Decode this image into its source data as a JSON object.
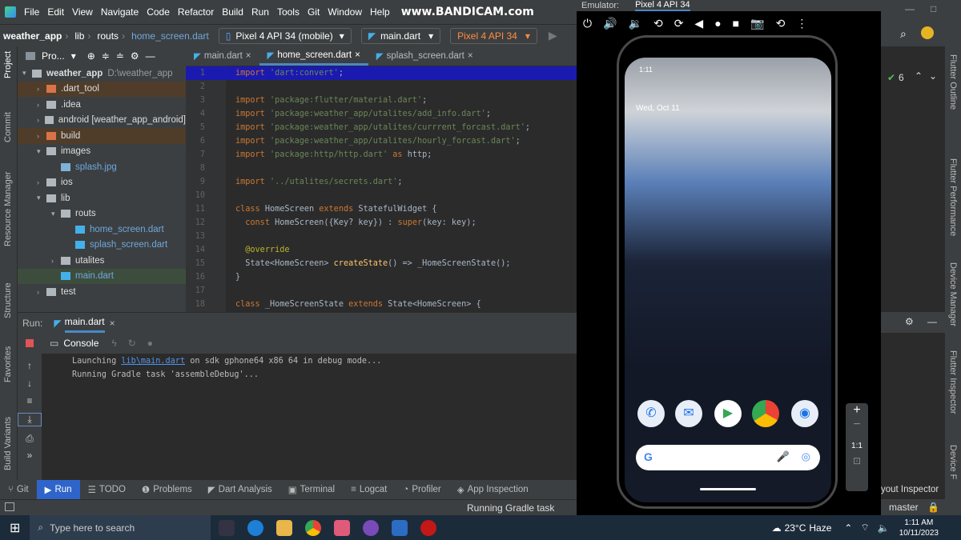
{
  "menubar": {
    "items": [
      "File",
      "Edit",
      "View",
      "Navigate",
      "Code",
      "Refactor",
      "Build",
      "Run",
      "Tools",
      "Git",
      "Window",
      "Help"
    ],
    "watermark": "www.BANDICAM.com"
  },
  "navbar": {
    "project": "weather_app",
    "crumbs": [
      "lib",
      "routs",
      "home_screen.dart"
    ],
    "device_combo": "Pixel 4 API 34 (mobile)",
    "run_config": "main.dart",
    "device_combo2": "Pixel 4 API 34"
  },
  "project_panel": {
    "header": "Pro...",
    "items": [
      {
        "label": "weather_app",
        "extra": "D:\\weather_app",
        "indent": 0,
        "type": "folder",
        "open": true
      },
      {
        "label": ".dart_tool",
        "indent": 1,
        "type": "folder-orange",
        "open": false
      },
      {
        "label": ".idea",
        "indent": 1,
        "type": "folder",
        "open": false
      },
      {
        "label": "android [weather_app_android]",
        "indent": 1,
        "type": "folder",
        "open": false
      },
      {
        "label": "build",
        "indent": 1,
        "type": "folder-orange",
        "open": false
      },
      {
        "label": "images",
        "indent": 1,
        "type": "folder",
        "open": true
      },
      {
        "label": "splash.jpg",
        "indent": 2,
        "type": "file",
        "open": null
      },
      {
        "label": "ios",
        "indent": 1,
        "type": "folder",
        "open": false
      },
      {
        "label": "lib",
        "indent": 1,
        "type": "folder",
        "open": true
      },
      {
        "label": "routs",
        "indent": 2,
        "type": "folder",
        "open": true
      },
      {
        "label": "home_screen.dart",
        "indent": 3,
        "type": "dart",
        "open": null
      },
      {
        "label": "splash_screen.dart",
        "indent": 3,
        "type": "dart",
        "open": null
      },
      {
        "label": "utalites",
        "indent": 2,
        "type": "folder",
        "open": false
      },
      {
        "label": "main.dart",
        "indent": 2,
        "type": "dart",
        "open": null
      },
      {
        "label": "test",
        "indent": 1,
        "type": "folder",
        "open": false
      }
    ]
  },
  "editor_tabs": [
    "main.dart",
    "home_screen.dart",
    "splash_screen.dart"
  ],
  "code_lines": [
    {
      "n": "1",
      "html": "<span class='kw'>import </span><span class='str'>'dart:convert'</span>;"
    },
    {
      "n": "2",
      "html": ""
    },
    {
      "n": "3",
      "html": "<span class='kw'>import </span><span class='str'>'package:flutter/material.dart'</span>;"
    },
    {
      "n": "4",
      "html": "<span class='kw'>import </span><span class='str'>'package:weather_app/utalites/add_info.dart'</span>;"
    },
    {
      "n": "5",
      "html": "<span class='kw'>import </span><span class='str'>'package:weather_app/utalites/currrent_forcast.dart'</span>;"
    },
    {
      "n": "6",
      "html": "<span class='kw'>import </span><span class='str'>'package:weather_app/utalites/hourly_forcast.dart'</span>;"
    },
    {
      "n": "7",
      "html": "<span class='kw'>import </span><span class='str'>'package:http/http.dart'</span> <span class='kw'>as</span> http;"
    },
    {
      "n": "8",
      "html": ""
    },
    {
      "n": "9",
      "html": "<span class='kw'>import </span><span class='str'>'../utalites/secrets.dart'</span>;"
    },
    {
      "n": "10",
      "html": ""
    },
    {
      "n": "11",
      "html": "<span class='kw'>class </span>HomeScreen <span class='kw'>extends </span>StatefulWidget {"
    },
    {
      "n": "12",
      "html": "  <span class='kw'>const </span>HomeScreen({Key? key}) : <span class='kw'>super</span>(key: key);"
    },
    {
      "n": "13",
      "html": ""
    },
    {
      "n": "14",
      "html": "  <span class='ann'>@override</span>"
    },
    {
      "n": "15",
      "html": "  State&lt;HomeScreen&gt; <span class='fn'>createState</span>() =&gt; _HomeScreenState();"
    },
    {
      "n": "16",
      "html": "}"
    },
    {
      "n": "17",
      "html": ""
    },
    {
      "n": "18",
      "html": "<span class='kw'>class </span>_HomeScreenState <span class='kw'>extends </span>State&lt;HomeScreen&gt; {"
    }
  ],
  "run_panel": {
    "label": "Run:",
    "tab": "main.dart",
    "console_tab": "Console",
    "lines": [
      {
        "prefix": "Launching ",
        "link": "lib\\main.dart",
        "suffix": " on sdk gphone64 x86 64 in debug mode..."
      },
      {
        "prefix": "Running Gradle task 'assembleDebug'...",
        "link": "",
        "suffix": ""
      }
    ]
  },
  "bottom_tabs": [
    "Git",
    "Run",
    "TODO",
    "Problems",
    "Dart Analysis",
    "Terminal",
    "Logcat",
    "Profiler",
    "App Inspection"
  ],
  "status_text": "Running Gradle task 'assemb",
  "side_labels": {
    "left": [
      "Project",
      "Commit",
      "Resource Manager",
      "Structure",
      "Favorites",
      "Build Variants"
    ],
    "right": [
      "Flutter Outline",
      "Flutter Performance",
      "Device Manager",
      "Flutter Inspector",
      "Device F"
    ]
  },
  "emulator": {
    "title": "Emulator:",
    "device_tab": "Pixel 4 API 34",
    "status_time": "1:11",
    "lock_date": "Wed, Oct 11",
    "zoom_label": "1:1"
  },
  "right_misc": {
    "warnings": "6",
    "layout_inspector": "yout Inspector",
    "branch": "master"
  },
  "taskbar": {
    "search_placeholder": "Type here to search",
    "temperature": "23°C",
    "weather": "Haze",
    "time": "1:11 AM",
    "date": "10/11/2023"
  }
}
